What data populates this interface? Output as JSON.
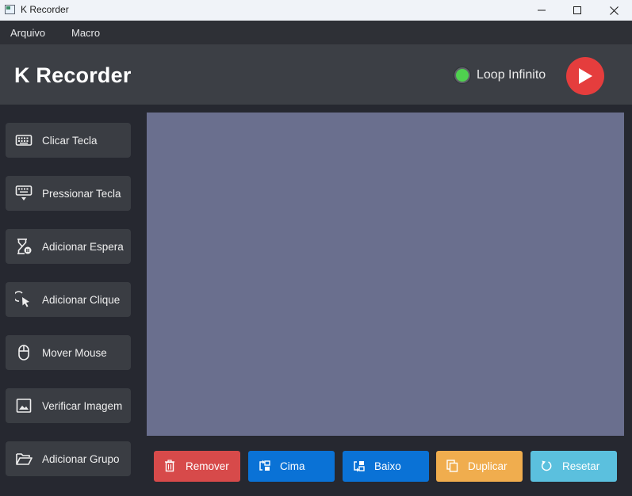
{
  "window": {
    "title": "K Recorder"
  },
  "menu": {
    "items": [
      {
        "label": "Arquivo"
      },
      {
        "label": "Macro"
      }
    ]
  },
  "header": {
    "title": "K Recorder",
    "loop_label": "Loop Infinito",
    "loop_enabled": true,
    "play_icon": "play-icon"
  },
  "sidebar": {
    "items": [
      {
        "label": "Clicar Tecla",
        "icon": "keyboard-icon"
      },
      {
        "label": "Pressionar Tecla",
        "icon": "keyboard-down-icon"
      },
      {
        "label": "Adicionar Espera",
        "icon": "hourglass-icon"
      },
      {
        "label": "Adicionar Clique",
        "icon": "mouse-click-icon"
      },
      {
        "label": "Mover Mouse",
        "icon": "mouse-icon"
      },
      {
        "label": "Verificar Imagem",
        "icon": "image-icon"
      },
      {
        "label": "Adicionar Grupo",
        "icon": "folder-open-icon"
      }
    ]
  },
  "actions": {
    "remover": "Remover",
    "cima": "Cima",
    "baixo": "Baixo",
    "duplicar": "Duplicar",
    "resetar": "Resetar"
  },
  "colors": {
    "accent_red": "#e53d3d",
    "primary_blue": "#0a72d6",
    "danger": "#d74a4a",
    "warning": "#f0ad4e",
    "info": "#5bc0de",
    "list_background": "#6a6f8e"
  }
}
